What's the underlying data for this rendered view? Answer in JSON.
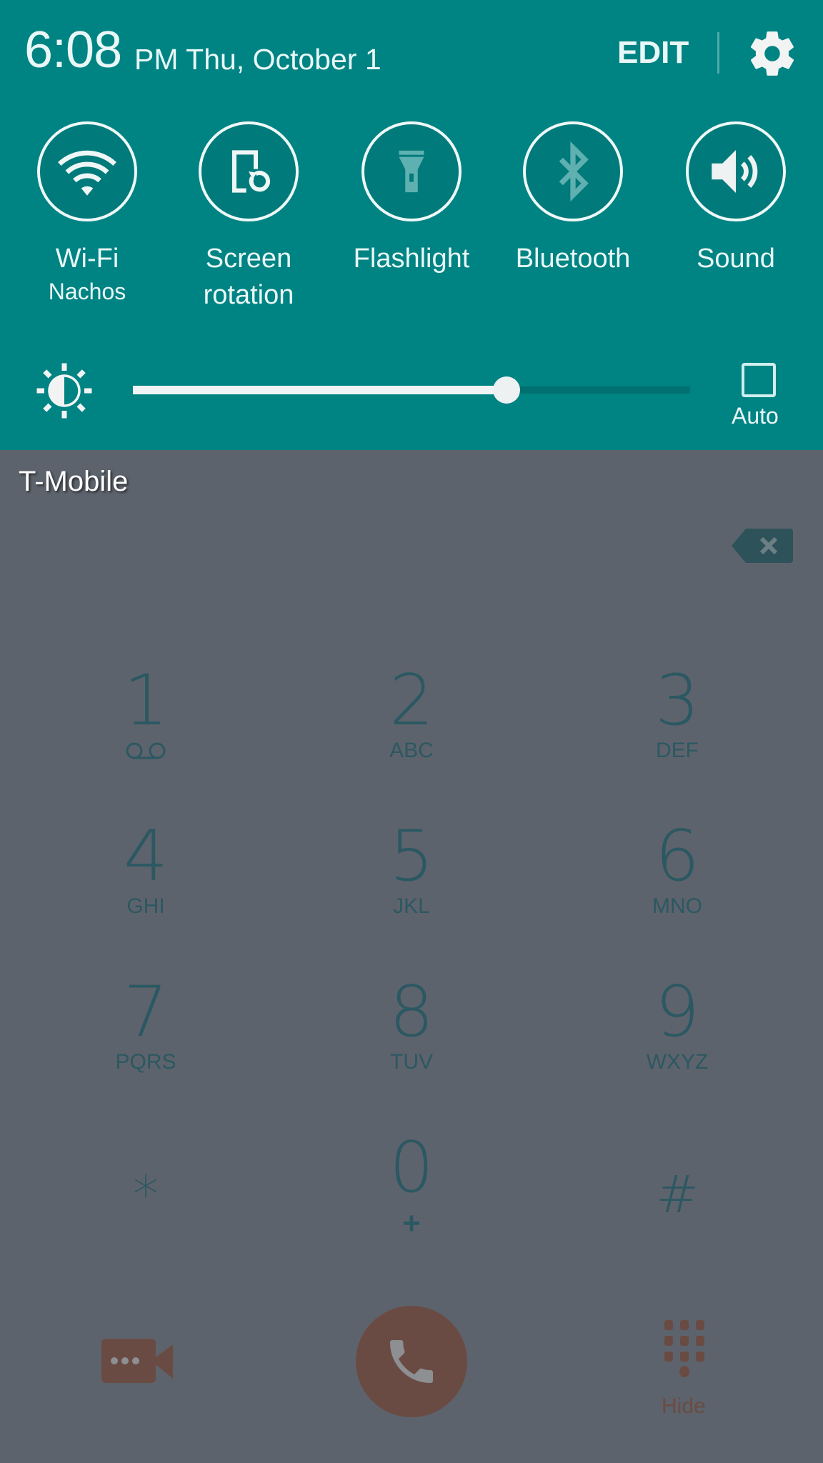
{
  "status": {
    "time": "6:08",
    "date": "PM Thu, October 1",
    "edit_label": "EDIT",
    "settings_icon": "gear-icon"
  },
  "quick_toggles": [
    {
      "label": "Wi-Fi",
      "sublabel": "Nachos",
      "icon": "wifi-icon",
      "state": "on"
    },
    {
      "label": "Screen",
      "sublabel": "rotation",
      "icon": "screen-rotation-icon",
      "state": "on"
    },
    {
      "label": "Flashlight",
      "sublabel": "",
      "icon": "flashlight-icon",
      "state": "off"
    },
    {
      "label": "Bluetooth",
      "sublabel": "",
      "icon": "bluetooth-icon",
      "state": "off"
    },
    {
      "label": "Sound",
      "sublabel": "",
      "icon": "sound-icon",
      "state": "on"
    }
  ],
  "brightness": {
    "level_percent": 67,
    "auto_label": "Auto",
    "auto_checked": false
  },
  "dialer": {
    "carrier": "T-Mobile",
    "keys": [
      {
        "num": "1",
        "letters": "",
        "icon": "voicemail-icon"
      },
      {
        "num": "2",
        "letters": "ABC"
      },
      {
        "num": "3",
        "letters": "DEF"
      },
      {
        "num": "4",
        "letters": "GHI"
      },
      {
        "num": "5",
        "letters": "JKL"
      },
      {
        "num": "6",
        "letters": "MNO"
      },
      {
        "num": "7",
        "letters": "PQRS"
      },
      {
        "num": "8",
        "letters": "TUV"
      },
      {
        "num": "9",
        "letters": "WXYZ"
      },
      {
        "num": "*",
        "letters": ""
      },
      {
        "num": "0",
        "letters": "+"
      },
      {
        "num": "#",
        "letters": ""
      }
    ],
    "hide_label": "Hide"
  },
  "colors": {
    "panel": "#008383",
    "dimmed_bg": "#5d636c",
    "key_text": "#2b5862",
    "action_brown": "#6a4b43"
  }
}
